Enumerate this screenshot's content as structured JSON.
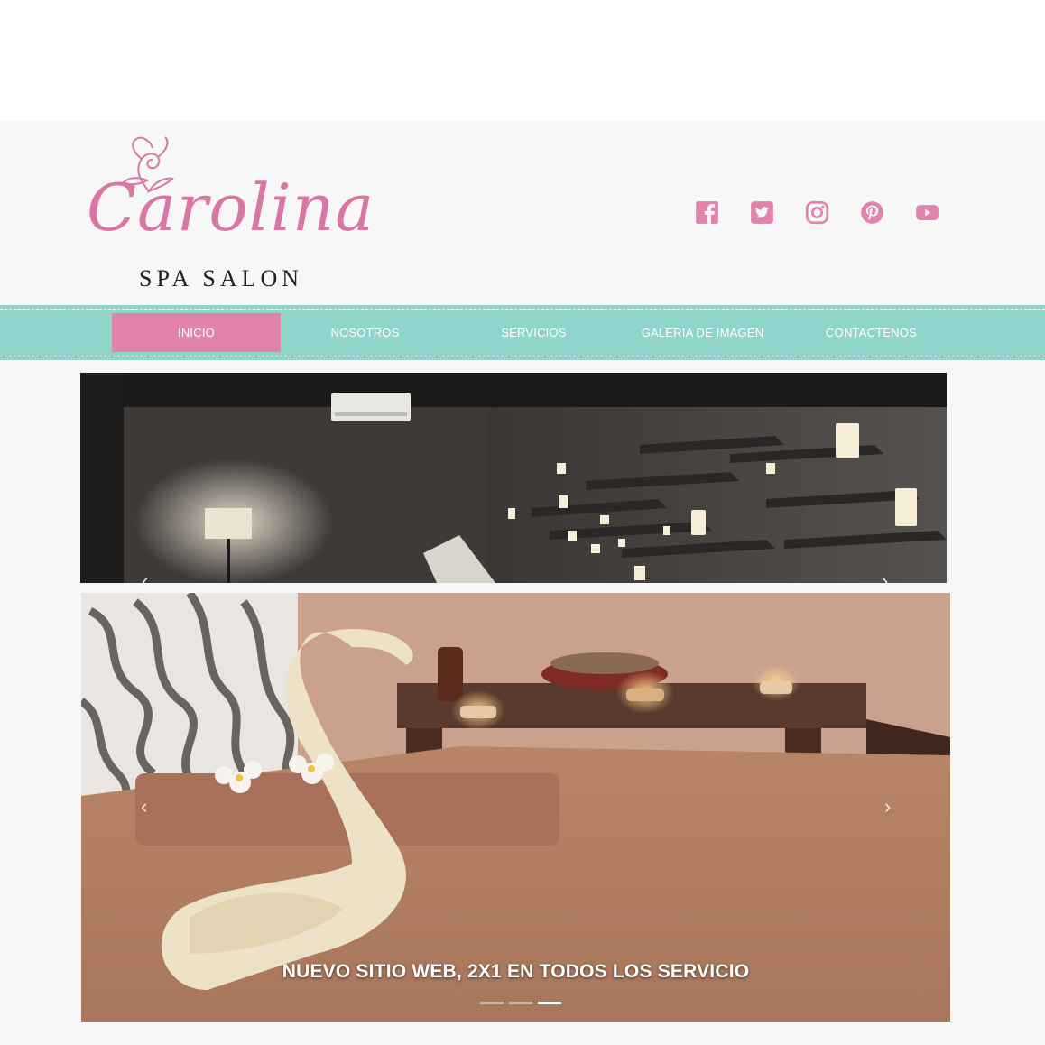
{
  "brand": {
    "name": "Carolina",
    "subtitle": "SPA SALON",
    "color": "#d977a4"
  },
  "social": [
    {
      "icon": "facebook-icon"
    },
    {
      "icon": "twitter-icon"
    },
    {
      "icon": "instagram-icon"
    },
    {
      "icon": "pinterest-icon"
    },
    {
      "icon": "youtube-icon"
    }
  ],
  "nav": {
    "items": [
      {
        "label": "INICIO",
        "active": true
      },
      {
        "label": "NOSOTROS",
        "active": false
      },
      {
        "label": "SERVICIOS",
        "active": false
      },
      {
        "label": "GALERIA DE IMAGEN",
        "active": false
      },
      {
        "label": "CONTACTENOS",
        "active": false
      }
    ],
    "bg_color": "#8fd5cc",
    "active_color": "#e183ad"
  },
  "slider": {
    "caption": "NUEVO SITIO WEB, 2X1 EN TODOS LOS SERVICIO",
    "slide_count": 3,
    "active_slide": 3
  }
}
